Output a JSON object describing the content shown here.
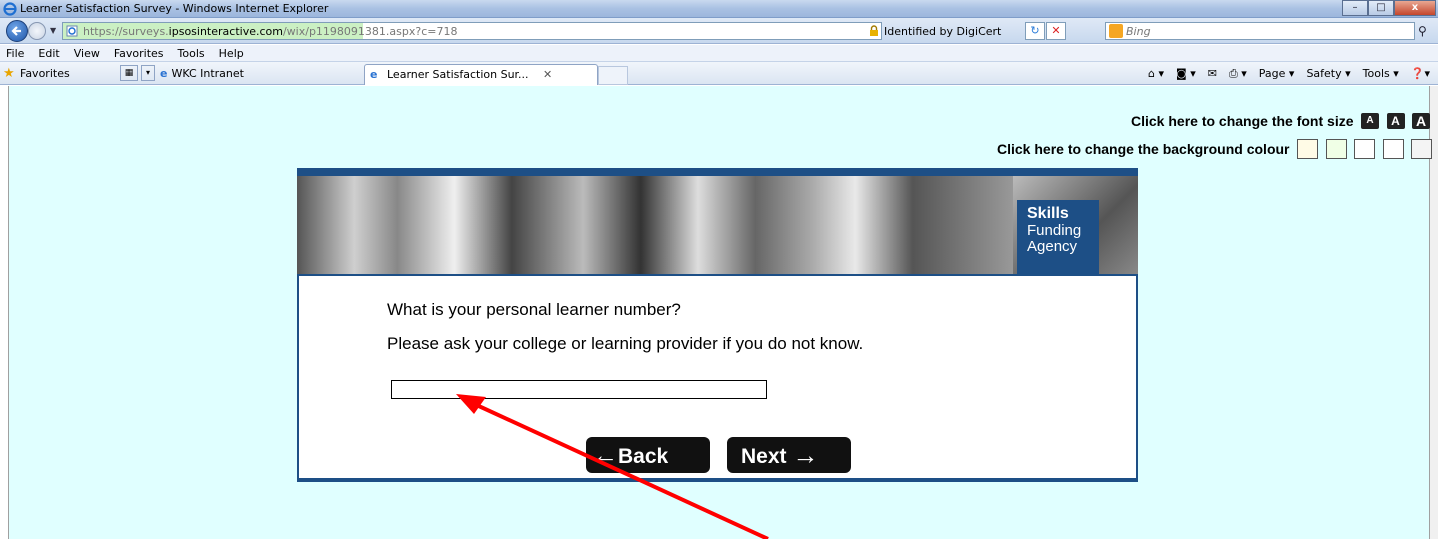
{
  "window": {
    "title": "Learner Satisfaction Survey - Windows Internet Explorer",
    "controls": {
      "minimize": "–",
      "maximize": "□",
      "close": "x"
    }
  },
  "addressbar": {
    "url_prefix": "https://surveys.",
    "url_domain": "ipsosinteractive.com",
    "url_path": "/wix/p1198091381.aspx?c=718",
    "certificate": "Identified by DigiCert",
    "search_placeholder": "Bing"
  },
  "menu": [
    "File",
    "Edit",
    "View",
    "Favorites",
    "Tools",
    "Help"
  ],
  "favorites_bar": {
    "favorites_label": "Favorites",
    "link": "WKC Intranet",
    "active_tab": "Learner Satisfaction Sur...",
    "commands": [
      "Page ▾",
      "Safety ▾",
      "Tools ▾"
    ]
  },
  "page": {
    "font_size_label": "Click here to change the font size",
    "font_size_buttons": [
      "A",
      "A",
      "A"
    ],
    "bg_colour_label": "Click here to change the background colour",
    "bg_swatches": [
      "#fffbe6",
      "#f0ffe6",
      "#ffffff",
      "#ffffff",
      "#f4f4f4"
    ],
    "brand": {
      "line1": "Skills",
      "line2": "Funding",
      "line3": "Agency"
    },
    "question": "What is your personal learner number?",
    "hint": "Please ask your college or learning provider if you do not know.",
    "answer_value": "",
    "back_label": "Back",
    "next_label": "Next"
  },
  "colors": {
    "content_bg": "#e0ffff",
    "brand_blue": "#1d4f86",
    "annotation_arrow": "#ff0000"
  }
}
